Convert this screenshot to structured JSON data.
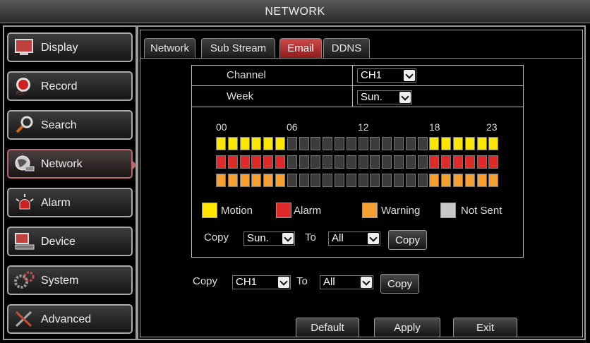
{
  "window": {
    "title": "NETWORK"
  },
  "sidebar": {
    "items": [
      {
        "label": "Display",
        "icon": "monitor-icon",
        "active": false
      },
      {
        "label": "Record",
        "icon": "record-icon",
        "active": false
      },
      {
        "label": "Search",
        "icon": "magnifier-icon",
        "active": false
      },
      {
        "label": "Network",
        "icon": "network-globe-icon",
        "active": true
      },
      {
        "label": "Alarm",
        "icon": "siren-icon",
        "active": false
      },
      {
        "label": "Device",
        "icon": "device-icon",
        "active": false
      },
      {
        "label": "System",
        "icon": "gears-icon",
        "active": false
      },
      {
        "label": "Advanced",
        "icon": "tools-icon",
        "active": false
      }
    ]
  },
  "tabs": [
    {
      "label": "Network",
      "active": false
    },
    {
      "label": "Sub Stream",
      "active": false
    },
    {
      "label": "Email",
      "active": true
    },
    {
      "label": "DDNS",
      "active": false
    }
  ],
  "form": {
    "channel_label": "Channel",
    "channel_value": "CH1",
    "week_label": "Week",
    "week_value": "Sun."
  },
  "schedule": {
    "hour_labels": [
      "00",
      "06",
      "12",
      "18",
      "23"
    ],
    "rows": [
      {
        "type": "Motion",
        "color": "#ffe600",
        "hours": [
          1,
          1,
          1,
          1,
          1,
          1,
          0,
          0,
          0,
          0,
          0,
          0,
          0,
          0,
          0,
          0,
          0,
          0,
          1,
          1,
          1,
          1,
          1,
          1
        ]
      },
      {
        "type": "Alarm",
        "color": "#e02a2a",
        "hours": [
          1,
          1,
          1,
          1,
          1,
          1,
          0,
          0,
          0,
          0,
          0,
          0,
          0,
          0,
          0,
          0,
          0,
          0,
          1,
          1,
          1,
          1,
          1,
          1
        ]
      },
      {
        "type": "Warning",
        "color": "#f5a030",
        "hours": [
          1,
          1,
          1,
          1,
          1,
          1,
          0,
          0,
          0,
          0,
          0,
          0,
          0,
          0,
          0,
          0,
          0,
          0,
          1,
          1,
          1,
          1,
          1,
          1
        ]
      }
    ],
    "empty_color": "#3c3c3c"
  },
  "legend": [
    {
      "label": "Motion",
      "color": "#ffe600"
    },
    {
      "label": "Alarm",
      "color": "#e02a2a"
    },
    {
      "label": "Warning",
      "color": "#f5a030"
    },
    {
      "label": "Not Sent",
      "color": "#c8c8c8"
    }
  ],
  "copy_day": {
    "copy_label": "Copy",
    "from": "Sun.",
    "to_label": "To",
    "to": "All",
    "button": "Copy"
  },
  "copy_channel": {
    "copy_label": "Copy",
    "from": "CH1",
    "to_label": "To",
    "to": "All",
    "button": "Copy"
  },
  "footer": {
    "default": "Default",
    "apply": "Apply",
    "exit": "Exit"
  }
}
